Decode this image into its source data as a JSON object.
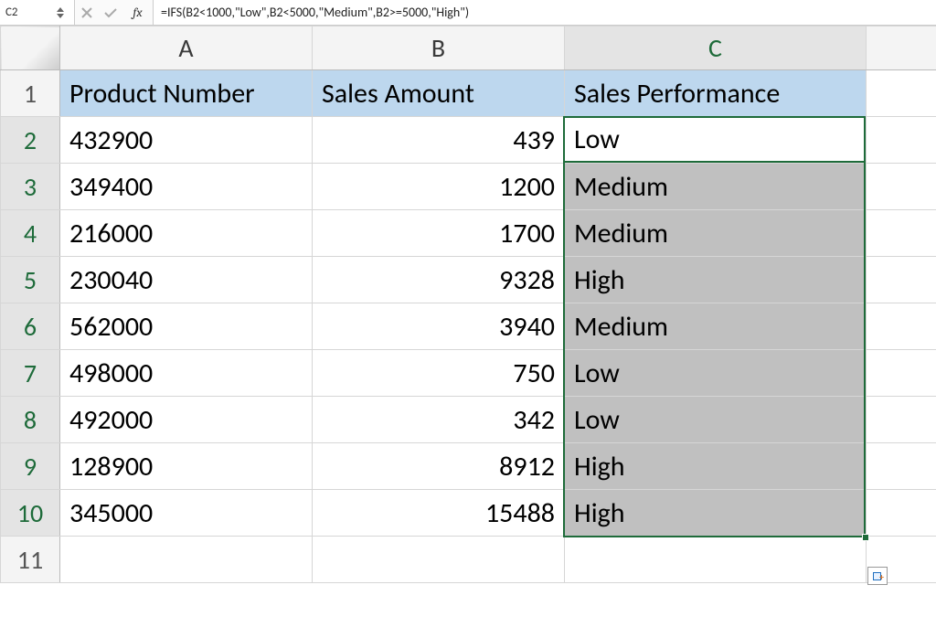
{
  "namebox": {
    "cell_ref": "C2"
  },
  "formula_bar": {
    "fx_label": "fx",
    "formula": "=IFS(B2<1000,\"Low\",B2<5000,\"Medium\",B2>=5000,\"High\")"
  },
  "column_headers": [
    "A",
    "B",
    "C"
  ],
  "row_headers": [
    "1",
    "2",
    "3",
    "4",
    "5",
    "6",
    "7",
    "8",
    "9",
    "10",
    "11"
  ],
  "table_headers": {
    "A": "Product Number",
    "B": "Sales Amount",
    "C": "Sales Performance"
  },
  "rows": [
    {
      "product": "432900",
      "sales": "439",
      "perf": "Low"
    },
    {
      "product": "349400",
      "sales": "1200",
      "perf": "Medium"
    },
    {
      "product": "216000",
      "sales": "1700",
      "perf": "Medium"
    },
    {
      "product": "230040",
      "sales": "9328",
      "perf": "High"
    },
    {
      "product": "562000",
      "sales": "3940",
      "perf": "Medium"
    },
    {
      "product": "498000",
      "sales": "750",
      "perf": "Low"
    },
    {
      "product": "492000",
      "sales": "342",
      "perf": "Low"
    },
    {
      "product": "128900",
      "sales": "8912",
      "perf": "High"
    },
    {
      "product": "345000",
      "sales": "15488",
      "perf": "High"
    }
  ]
}
